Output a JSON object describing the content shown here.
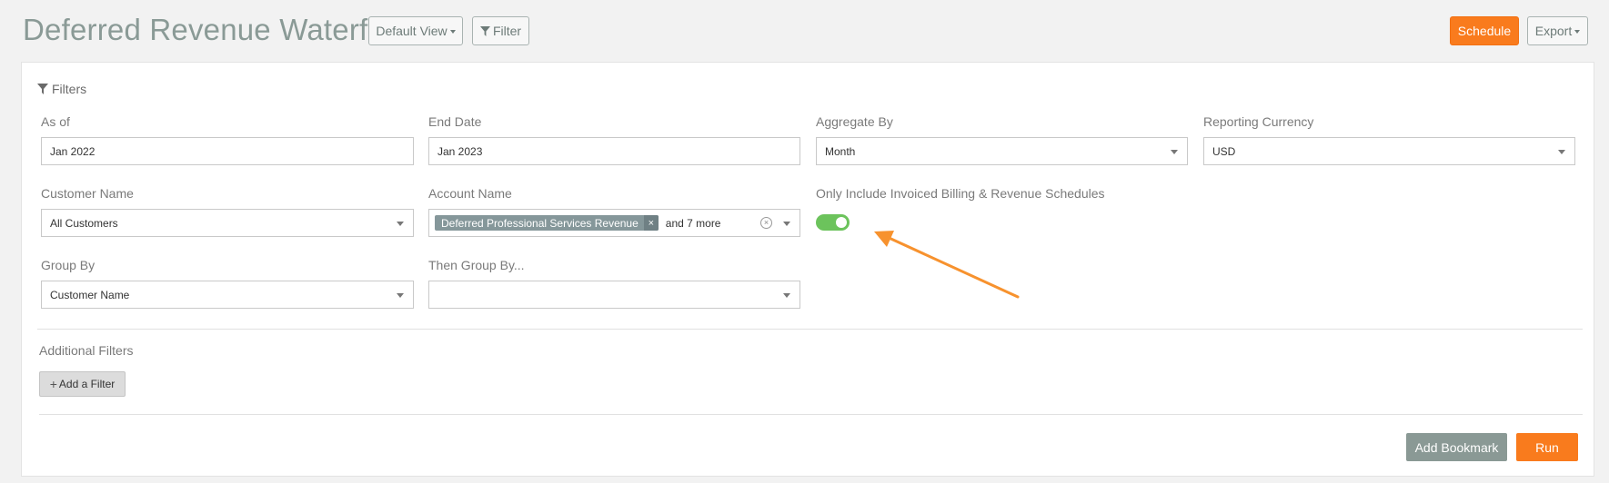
{
  "header": {
    "title": "Deferred Revenue Waterfall",
    "default_view_label": "Default View",
    "filter_label": "Filter",
    "schedule_label": "Schedule",
    "export_label": "Export"
  },
  "filters": {
    "heading": "Filters",
    "as_of": {
      "label": "As of",
      "value": "Jan 2022"
    },
    "end_date": {
      "label": "End Date",
      "value": "Jan 2023"
    },
    "aggregate_by": {
      "label": "Aggregate By",
      "value": "Month"
    },
    "reporting_currency": {
      "label": "Reporting Currency",
      "value": "USD"
    },
    "customer_name": {
      "label": "Customer Name",
      "value": "All Customers"
    },
    "account_name": {
      "label": "Account Name",
      "tag": "Deferred Professional Services Revenue",
      "tag_remove": "×",
      "more": "and 7 more"
    },
    "invoiced_only": {
      "label": "Only Include Invoiced Billing & Revenue Schedules",
      "enabled": true
    },
    "group_by": {
      "label": "Group By",
      "value": "Customer Name"
    },
    "then_group_by": {
      "label": "Then Group By...",
      "value": ""
    }
  },
  "additional_filters": {
    "heading": "Additional Filters",
    "add_label": "Add a Filter"
  },
  "footer": {
    "bookmark_label": "Add Bookmark",
    "run_label": "Run"
  },
  "colors": {
    "accent": "#f97b1d",
    "toggle_on": "#6cc35c",
    "title": "#8a9a96",
    "tag": "#85979a"
  }
}
